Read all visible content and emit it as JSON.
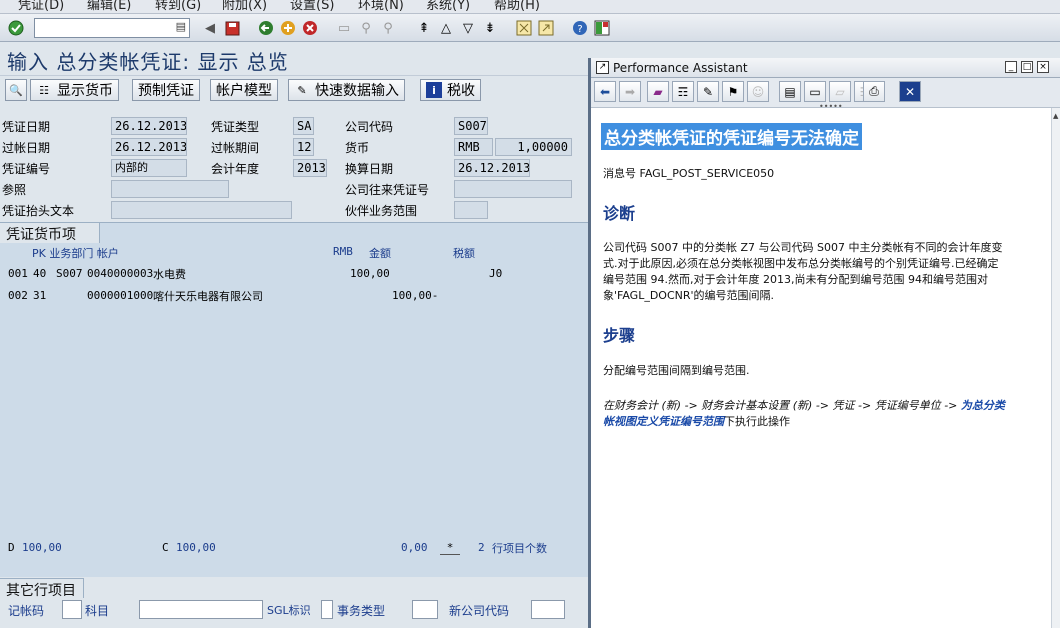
{
  "menu": [
    "凭证(D)",
    "编辑(E)",
    "转到(G)",
    "附加(X)",
    "设置(S)",
    "环境(N)",
    "系统(Y)",
    "帮助(H)"
  ],
  "icons": {
    "check": "check-icon",
    "save": "save-icon",
    "back": "back-icon",
    "exit": "exit-icon",
    "cancel": "cancel-icon"
  },
  "screen_title": "输入 总分类帐凭证: 显示 总览",
  "app_toolbar": {
    "show_currency": "显示货币",
    "park": "预制凭证",
    "acct_model": "帐户模型",
    "fast_entry": "快速数据输入",
    "tax": "税收"
  },
  "header": {
    "doc_date_label": "凭证日期",
    "doc_date": "26.12.2013",
    "doc_type_label": "凭证类型",
    "doc_type": "SA",
    "company_code_label": "公司代码",
    "company_code": "S007",
    "posting_date_label": "过帐日期",
    "posting_date": "26.12.2013",
    "period_label": "过帐期间",
    "period": "12",
    "currency_label": "货币",
    "currency": "RMB",
    "rate": "1,00000",
    "doc_no_label": "凭证编号",
    "doc_no": "内部的",
    "fiscal_year_label": "会计年度",
    "fiscal_year": "2013",
    "transl_date_label": "换算日期",
    "transl_date": "26.12.2013",
    "reference_label": "参照",
    "cross_cc_label": "公司往来凭证号",
    "header_text_label": "凭证抬头文本",
    "partner_ba_label": "伙伴业务范围"
  },
  "items_tab": "凭证货币项",
  "items_header": {
    "pk": "PK 业务部门 帐户",
    "rmb": "RMB",
    "amount": "金额",
    "tax": "税额"
  },
  "items": [
    {
      "no": "001",
      "pk": "40",
      "bus_area": "S007",
      "account": "0040000003",
      "name": "水电费",
      "amount": "100,00",
      "tax": "J0"
    },
    {
      "no": "002",
      "pk": "31",
      "bus_area": "",
      "account": "0000001000",
      "name": "喀什天乐电器有限公司",
      "amount": "100,00-",
      "tax": ""
    }
  ],
  "totals": {
    "d_label": "D",
    "d_value": "100,00",
    "c_label": "C",
    "c_value": "100,00",
    "balance": "0,00",
    "star": "*",
    "count": "2",
    "count_label": "行项目个数"
  },
  "other": {
    "tab": "其它行项目",
    "posting_key_label": "记帐码",
    "account_label": "科目",
    "sgl_label": "SGL标识",
    "trans_type_label": "事务类型",
    "new_cc_label": "新公司代码"
  },
  "pa": {
    "window_title": "Performance Assistant",
    "heading": "总分类帐凭证的凭证编号无法确定",
    "msg_no": "消息号 FAGL_POST_SERVICE050",
    "diag_title": "诊断",
    "diag_lines": [
      "公司代码 S007 中的分类帐 Z7 与公司代码 S007 中主分类帐有不同的会计年度变",
      "式.对于此原因,必须在总分类帐视图中发布总分类帐编号的个别凭证编号.已经确定",
      "编号范围 94.然而,对于会计年度 2013,尚未有分配到编号范围 94和编号范围对",
      "象'FAGL_DOCNR'的编号范围间隔."
    ],
    "steps_title": "步骤",
    "steps_line": "分配编号范围间隔到编号范围.",
    "path_text": "在财务会计 (新) -> 财务会计基本设置 (新) -> 凭证 -> 凭证编号单位 -> ",
    "path_link_1": "为总分类",
    "path_link_2": "帐视图定义凭证编号范围",
    "path_end": "下执行此操作"
  }
}
